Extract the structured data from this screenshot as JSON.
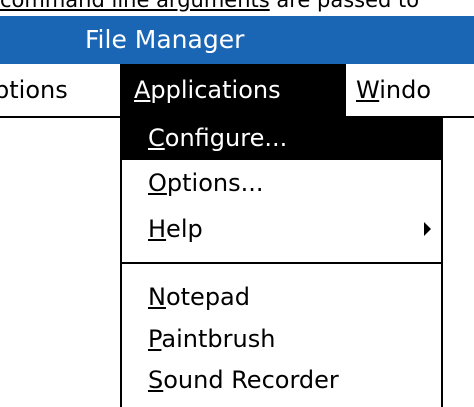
{
  "doc_line": {
    "link_text": "command line arguments",
    "rest_text": " are passed to"
  },
  "window": {
    "title": "File Manager"
  },
  "menubar": {
    "options": {
      "label": "ptions"
    },
    "applications": {
      "accel": "A",
      "rest": "pplications"
    },
    "window": {
      "accel": "W",
      "rest": "indo"
    }
  },
  "applications_menu": {
    "configure": {
      "accel": "C",
      "rest": "onfigure..."
    },
    "options": {
      "accel": "O",
      "rest": "ptions..."
    },
    "help": {
      "accel": "H",
      "rest": "elp"
    },
    "notepad": {
      "accel": "N",
      "rest": "otepad"
    },
    "paintbrush": {
      "accel": "P",
      "rest": "aintbrush"
    },
    "sound_recorder": {
      "accel": "S",
      "rest": "ound Recorder"
    }
  },
  "colors": {
    "titlebar": "#1a65b4",
    "selection": "#000000",
    "background": "#ffffff"
  },
  "icons": {
    "submenu_arrow": "triangle-right"
  }
}
